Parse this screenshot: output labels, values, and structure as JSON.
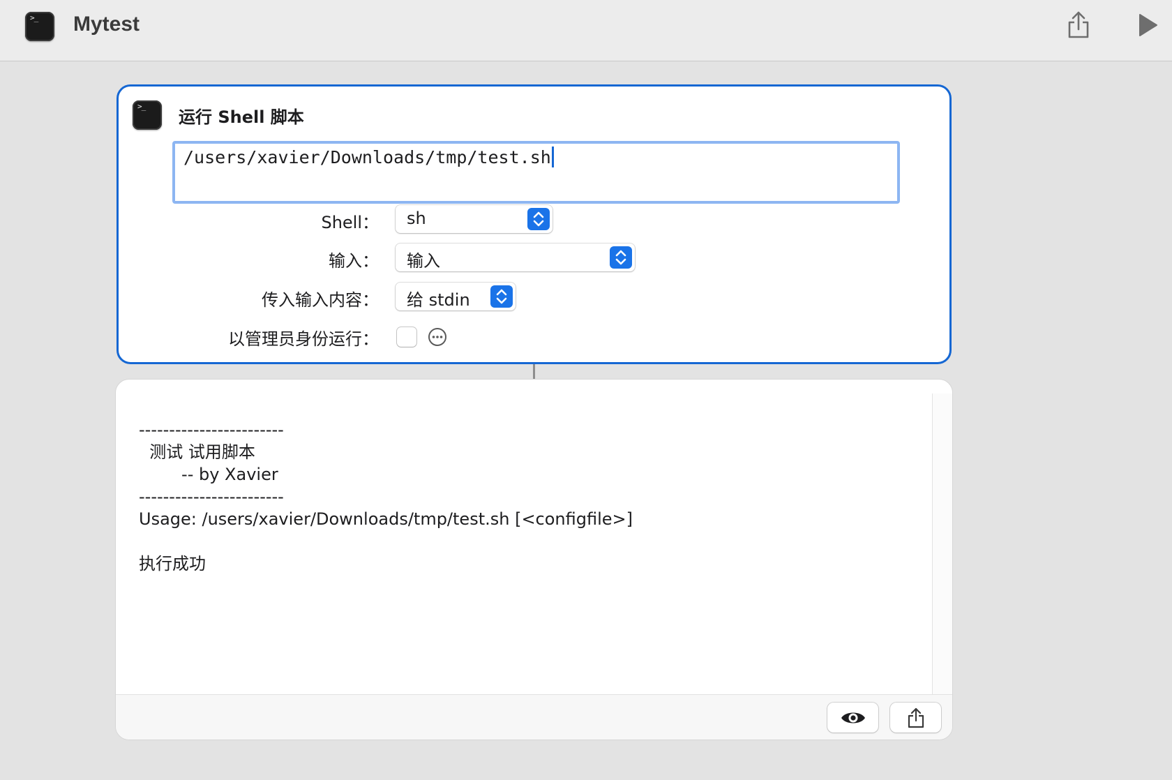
{
  "app": {
    "title": "Mytest"
  },
  "action": {
    "title": "运行 Shell 脚本",
    "script": "/users/xavier/Downloads/tmp/test.sh",
    "shell_label": "Shell：",
    "shell_value": "sh",
    "input_label": "输入：",
    "input_value": "输入",
    "pass_input_label": "传入输入内容：",
    "pass_input_value": "给 stdin",
    "run_as_admin_label": "以管理员身份运行：",
    "run_as_admin_checked": false
  },
  "result": {
    "lines": [
      "------------------------",
      "  测试 试用脚本",
      "        -- by Xavier",
      "------------------------",
      "Usage: /users/xavier/Downloads/tmp/test.sh [<configfile>]",
      "",
      "执行成功"
    ]
  },
  "colors": {
    "accent": "#1567d3",
    "stepper": "#1a73e8",
    "background": "#e3e3e3"
  },
  "icons": {
    "app": "terminal-icon",
    "share": "share-icon",
    "run": "play-icon",
    "more": "ellipsis-circle-icon",
    "preview": "eye-icon"
  }
}
